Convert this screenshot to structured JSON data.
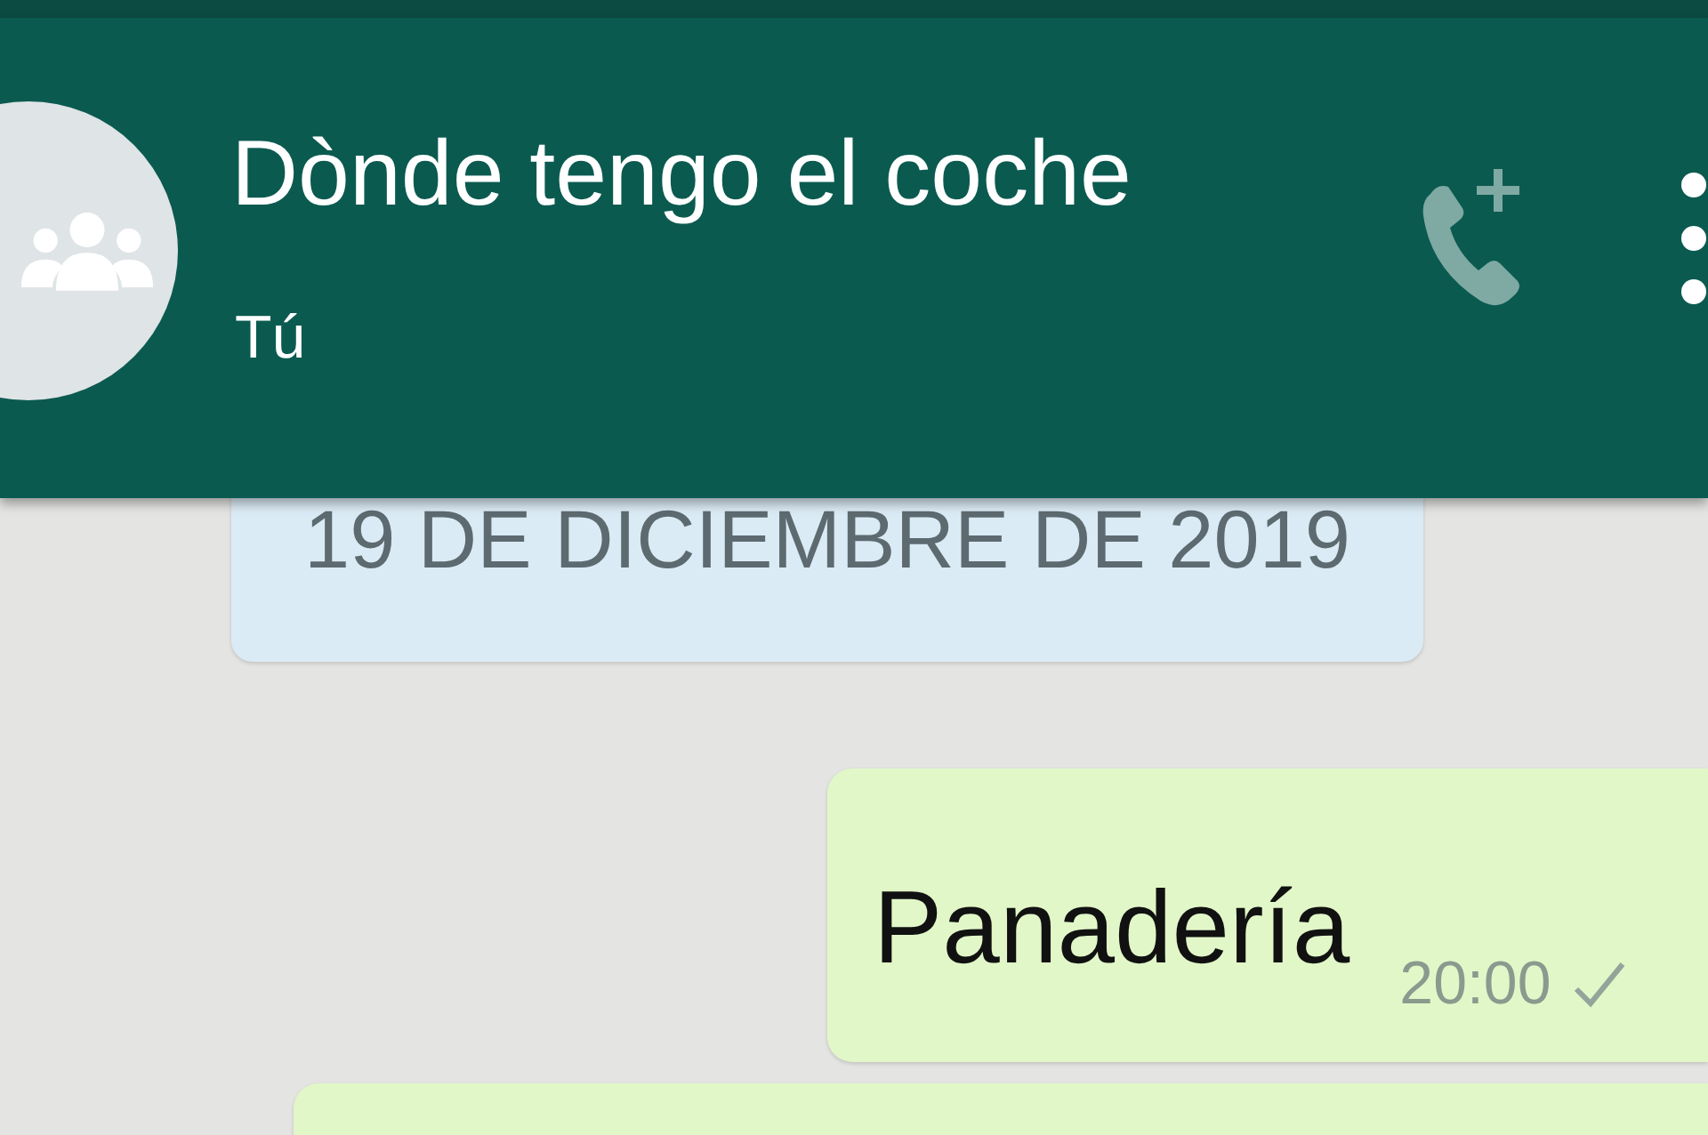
{
  "header": {
    "title": "Dònde tengo el coche",
    "subtitle": "Tú"
  },
  "date_divider": "19 DE DICIEMBRE DE 2019",
  "messages": [
    {
      "outgoing": true,
      "text": "Panadería",
      "time": "20:00",
      "delivered": false
    },
    {
      "outgoing": true
    }
  ]
}
